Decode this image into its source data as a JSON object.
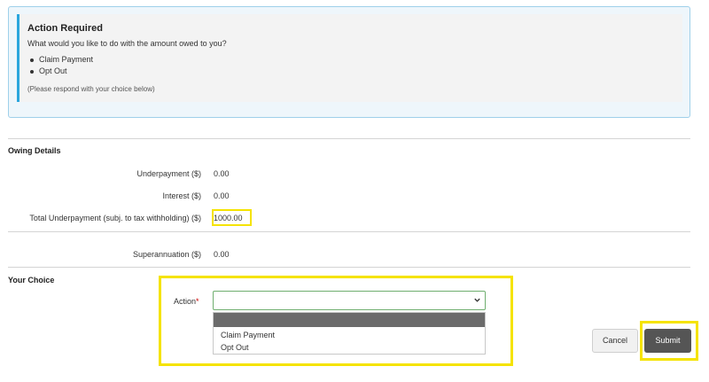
{
  "notice": {
    "title": "Action Required",
    "question": "What would you like to do with the amount owed to you?",
    "options": [
      "Claim Payment",
      "Opt Out"
    ],
    "note": "(Please respond with your choice below)"
  },
  "owing": {
    "section_title": "Owing Details",
    "rows": [
      {
        "label": "Underpayment ($)",
        "value": "0.00"
      },
      {
        "label": "Interest ($)",
        "value": "0.00"
      },
      {
        "label": "Total Underpayment (subj. to tax withholding) ($)",
        "value": "1000.00"
      },
      {
        "label": "Superannuation ($)",
        "value": "0.00"
      }
    ]
  },
  "choice": {
    "section_title": "Your Choice",
    "action_label": "Action",
    "required_marker": "*",
    "selected_value": "",
    "dropdown_options": [
      "",
      "Claim Payment",
      "Opt Out"
    ]
  },
  "buttons": {
    "cancel": "Cancel",
    "submit": "Submit"
  },
  "colors": {
    "accent_blue": "#2aa6dd",
    "highlight_yellow": "#f5e300",
    "submit_bg": "#555555",
    "required_red": "#cc0000"
  },
  "icons": {
    "select": "chevron-down-icon"
  }
}
